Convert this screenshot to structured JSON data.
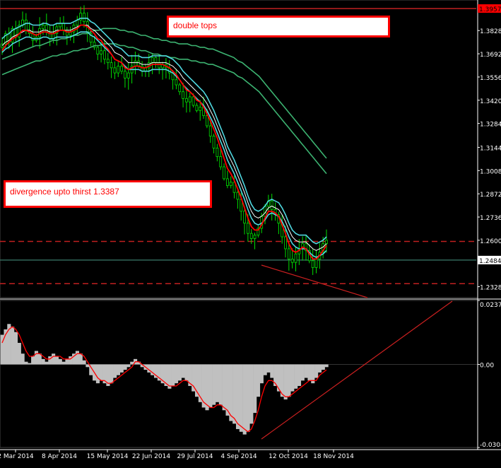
{
  "colors": {
    "background": "#000000",
    "up_candle": "#00e000",
    "down_candle": "#00e000",
    "ma_fast": "#ff0000",
    "envelope_band": "#4fd8e0",
    "ma_slow": "#3cb371",
    "histogram": "#c0c0c0",
    "signal_line": "#ff0000",
    "trendline": "#cc2020",
    "level_line": "#c02020",
    "current_price_line": "#3a7a6a",
    "axis_text": "#ffffff",
    "grid": "#2a2a2a",
    "note_border": "#ff0000",
    "note_text": "#ff0000"
  },
  "annotations": {
    "double_tops": "double tops",
    "divergence": "divergence upto thirst 1.3387"
  },
  "price_labels": {
    "top_level": "1.3957",
    "current": "1.2484"
  },
  "chart_data": [
    {
      "type": "candlestick",
      "panel": "price",
      "y_ticks": [
        "1.3828",
        "1.3692",
        "1.3556",
        "1.3420",
        "1.3284",
        "1.3144",
        "1.3008",
        "1.2872",
        "1.2736",
        "1.2600",
        "1.2328"
      ],
      "ylim": [
        1.2264,
        1.4007
      ],
      "x_ticks": [
        "2 Mar 2014",
        "8 Apr 2014",
        "15 May 2014",
        "22 Jun 2014",
        "29 Jul 2014",
        "4 Sep 2014",
        "12 Oct 2014",
        "18 Nov 2014"
      ],
      "close_series": [
        1.375,
        1.381,
        1.376,
        1.384,
        1.379,
        1.386,
        1.389,
        1.383,
        1.381,
        1.377,
        1.379,
        1.384,
        1.386,
        1.382,
        1.378,
        1.381,
        1.385,
        1.387,
        1.383,
        1.38,
        1.382,
        1.386,
        1.389,
        1.393,
        1.388,
        1.381,
        1.376,
        1.373,
        1.369,
        1.371,
        1.366,
        1.364,
        1.361,
        1.358,
        1.362,
        1.359,
        1.355,
        1.358,
        1.362,
        1.365,
        1.362,
        1.359,
        1.361,
        1.364,
        1.367,
        1.364,
        1.361,
        1.363,
        1.361,
        1.358,
        1.354,
        1.351,
        1.347,
        1.343,
        1.341,
        1.344,
        1.339,
        1.336,
        1.338,
        1.333,
        1.327,
        1.321,
        1.314,
        1.309,
        1.303,
        1.296,
        1.292,
        1.294,
        1.288,
        1.284,
        1.277,
        1.27,
        1.264,
        1.261,
        1.263,
        1.267,
        1.274,
        1.28,
        1.283,
        1.278,
        1.275,
        1.27,
        1.262,
        1.255,
        1.249,
        1.247,
        1.252,
        1.255,
        1.258,
        1.254,
        1.248,
        1.244,
        1.249,
        1.253,
        1.258,
        1.26
      ],
      "red_ma": [
        1.371,
        1.374,
        1.376,
        1.378,
        1.379,
        1.381,
        1.383,
        1.383,
        1.382,
        1.381,
        1.38,
        1.381,
        1.382,
        1.382,
        1.381,
        1.381,
        1.382,
        1.383,
        1.383,
        1.382,
        1.382,
        1.383,
        1.384,
        1.386,
        1.386,
        1.385,
        1.383,
        1.381,
        1.378,
        1.377,
        1.374,
        1.372,
        1.369,
        1.366,
        1.365,
        1.364,
        1.361,
        1.36,
        1.361,
        1.362,
        1.362,
        1.361,
        1.361,
        1.362,
        1.363,
        1.363,
        1.363,
        1.363,
        1.362,
        1.361,
        1.359,
        1.357,
        1.354,
        1.351,
        1.348,
        1.347,
        1.345,
        1.342,
        1.341,
        1.338,
        1.334,
        1.33,
        1.325,
        1.32,
        1.314,
        1.308,
        1.302,
        1.299,
        1.295,
        1.29,
        1.285,
        1.279,
        1.273,
        1.268,
        1.266,
        1.266,
        1.269,
        1.273,
        1.277,
        1.277,
        1.276,
        1.274,
        1.269,
        1.264,
        1.258,
        1.254,
        1.253,
        1.254,
        1.256,
        1.255,
        1.252,
        1.249,
        1.249,
        1.251,
        1.254,
        1.257
      ],
      "cyan_band": [
        1.374,
        1.376,
        1.377,
        1.379,
        1.38,
        1.381,
        1.382,
        1.383,
        1.383,
        1.382,
        1.382,
        1.382,
        1.383,
        1.383,
        1.382,
        1.382,
        1.383,
        1.383,
        1.383,
        1.383,
        1.383,
        1.384,
        1.385,
        1.386,
        1.386,
        1.386,
        1.384,
        1.383,
        1.381,
        1.379,
        1.377,
        1.375,
        1.373,
        1.37,
        1.369,
        1.368,
        1.366,
        1.364,
        1.364,
        1.364,
        1.364,
        1.363,
        1.363,
        1.363,
        1.364,
        1.364,
        1.364,
        1.364,
        1.364,
        1.363,
        1.362,
        1.36,
        1.358,
        1.355,
        1.353,
        1.351,
        1.349,
        1.347,
        1.345,
        1.343,
        1.34,
        1.336,
        1.332,
        1.327,
        1.322,
        1.317,
        1.311,
        1.307,
        1.303,
        1.298,
        1.293,
        1.288,
        1.282,
        1.277,
        1.274,
        1.273,
        1.274,
        1.276,
        1.279,
        1.28,
        1.279,
        1.278,
        1.275,
        1.271,
        1.266,
        1.262,
        1.26,
        1.259,
        1.259,
        1.259,
        1.257,
        1.255,
        1.254,
        1.255,
        1.256,
        1.258
      ],
      "slow_ma": [
        1.36,
        1.361,
        1.362,
        1.363,
        1.364,
        1.365,
        1.366,
        1.367,
        1.368,
        1.368,
        1.369,
        1.37,
        1.371,
        1.371,
        1.372,
        1.372,
        1.373,
        1.374,
        1.374,
        1.375,
        1.375,
        1.376,
        1.377,
        1.377,
        1.378,
        1.378,
        1.378,
        1.378,
        1.377,
        1.377,
        1.376,
        1.376,
        1.375,
        1.374,
        1.374,
        1.373,
        1.372,
        1.372,
        1.371,
        1.371,
        1.37,
        1.37,
        1.369,
        1.369,
        1.369,
        1.368,
        1.368,
        1.367,
        1.367,
        1.366,
        1.366,
        1.365,
        1.364,
        1.363,
        1.362,
        1.361,
        1.359,
        1.358,
        1.356,
        1.354,
        1.352,
        1.35,
        1.347,
        1.344,
        1.341,
        1.338,
        1.335,
        1.332,
        1.329,
        1.326,
        1.323,
        1.32,
        1.317,
        1.314,
        1.311,
        1.308,
        1.305,
        1.302
      ],
      "horizontal_levels": [
        {
          "value": 1.3957,
          "style": "solid"
        },
        {
          "value": 1.2593,
          "style": "dashed"
        },
        {
          "value": 1.2484,
          "style": "solid"
        },
        {
          "value": 1.2346,
          "style": "dashed"
        }
      ]
    },
    {
      "type": "bar",
      "panel": "oscillator",
      "y_ticks": [
        "0.02373",
        "0.00",
        "-0.03083"
      ],
      "ylim": [
        -0.03083,
        0.02373
      ],
      "values": [
        0.011,
        0.013,
        0.015,
        0.014,
        0.012,
        0.008,
        0.004,
        0.001,
        0.0005,
        0.003,
        0.005,
        0.004,
        0.002,
        0.001,
        0.003,
        0.004,
        0.003,
        0.002,
        0.001,
        0.002,
        0.003,
        0.004,
        0.005,
        0.004,
        0.0015,
        -0.001,
        -0.004,
        -0.006,
        -0.007,
        -0.006,
        -0.007,
        -0.008,
        -0.007,
        -0.005,
        -0.004,
        -0.003,
        -0.002,
        -0.001,
        0.001,
        0.002,
        0.001,
        -0.001,
        -0.002,
        -0.003,
        -0.004,
        -0.005,
        -0.006,
        -0.007,
        -0.008,
        -0.009,
        -0.008,
        -0.007,
        -0.006,
        -0.005,
        -0.006,
        -0.008,
        -0.01,
        -0.012,
        -0.014,
        -0.016,
        -0.017,
        -0.016,
        -0.015,
        -0.014,
        -0.015,
        -0.017,
        -0.019,
        -0.021,
        -0.022,
        -0.024,
        -0.025,
        -0.026,
        -0.025,
        -0.022,
        -0.018,
        -0.012,
        -0.007,
        -0.004,
        -0.003,
        -0.005,
        -0.008,
        -0.01,
        -0.012,
        -0.013,
        -0.012,
        -0.01,
        -0.009,
        -0.008,
        -0.006,
        -0.005,
        -0.006,
        -0.007,
        -0.005,
        -0.003,
        -0.002,
        -0.001
      ],
      "signal": [
        0.008,
        0.011,
        0.013,
        0.014,
        0.013,
        0.011,
        0.008,
        0.005,
        0.003,
        0.003,
        0.004,
        0.004,
        0.003,
        0.002,
        0.002,
        0.003,
        0.003,
        0.003,
        0.002,
        0.002,
        0.002,
        0.003,
        0.004,
        0.004,
        0.003,
        0.001,
        -0.001,
        -0.003,
        -0.005,
        -0.006,
        -0.006,
        -0.007,
        -0.007,
        -0.006,
        -0.005,
        -0.004,
        -0.003,
        -0.002,
        -0.001,
        0.001,
        0.001,
        0.0,
        -0.001,
        -0.002,
        -0.003,
        -0.004,
        -0.005,
        -0.006,
        -0.007,
        -0.008,
        -0.008,
        -0.008,
        -0.007,
        -0.006,
        -0.006,
        -0.007,
        -0.008,
        -0.01,
        -0.012,
        -0.014,
        -0.015,
        -0.016,
        -0.016,
        -0.015,
        -0.015,
        -0.016,
        -0.017,
        -0.019,
        -0.02,
        -0.022,
        -0.023,
        -0.024,
        -0.025,
        -0.024,
        -0.021,
        -0.017,
        -0.012,
        -0.008,
        -0.006,
        -0.006,
        -0.007,
        -0.009,
        -0.011,
        -0.012,
        -0.012,
        -0.011,
        -0.01,
        -0.009,
        -0.008,
        -0.007,
        -0.006,
        -0.006,
        -0.006,
        -0.004,
        -0.003,
        -0.002
      ]
    }
  ]
}
